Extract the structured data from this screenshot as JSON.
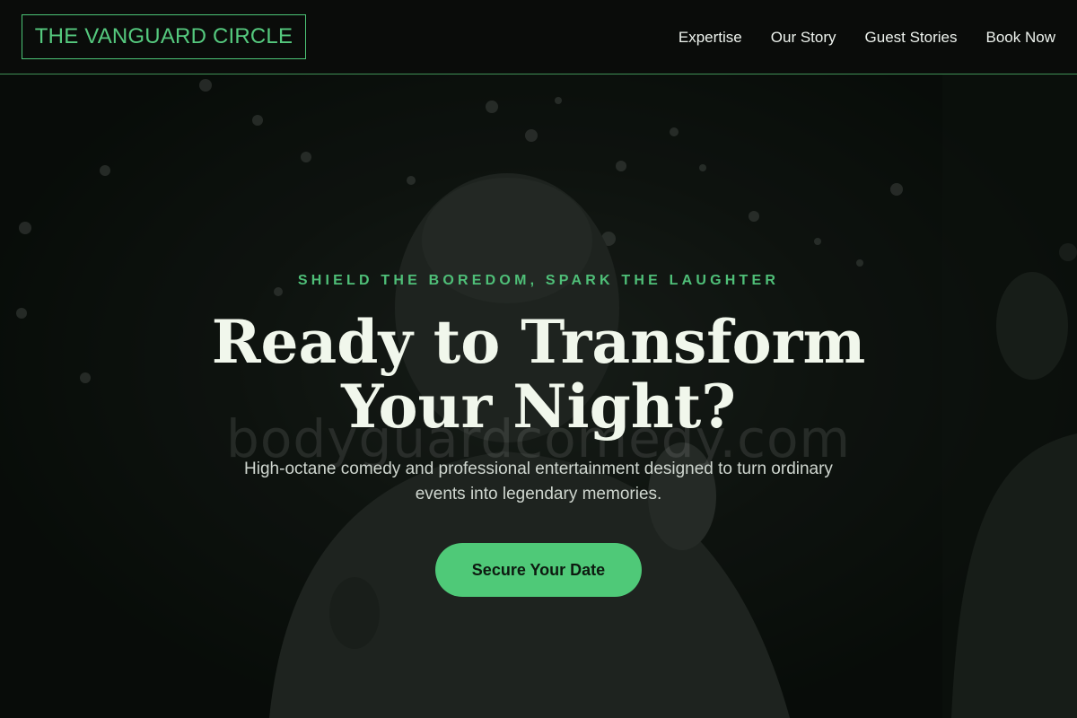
{
  "brand": {
    "logo_text": "THE VANGUARD CIRCLE",
    "accent_color": "#4fc978"
  },
  "nav": {
    "items": [
      {
        "label": "Expertise"
      },
      {
        "label": "Our Story"
      },
      {
        "label": "Guest Stories"
      },
      {
        "label": "Book Now"
      }
    ]
  },
  "hero": {
    "eyebrow": "SHIELD THE BOREDOM, SPARK THE LAUGHTER",
    "headline": "Ready to Transform Your Night?",
    "subhead": "High-octane comedy and professional entertainment designed to turn ordinary events into legendary memories.",
    "cta_label": "Secure Your Date",
    "watermark": "bodyguardcomedy.com"
  }
}
